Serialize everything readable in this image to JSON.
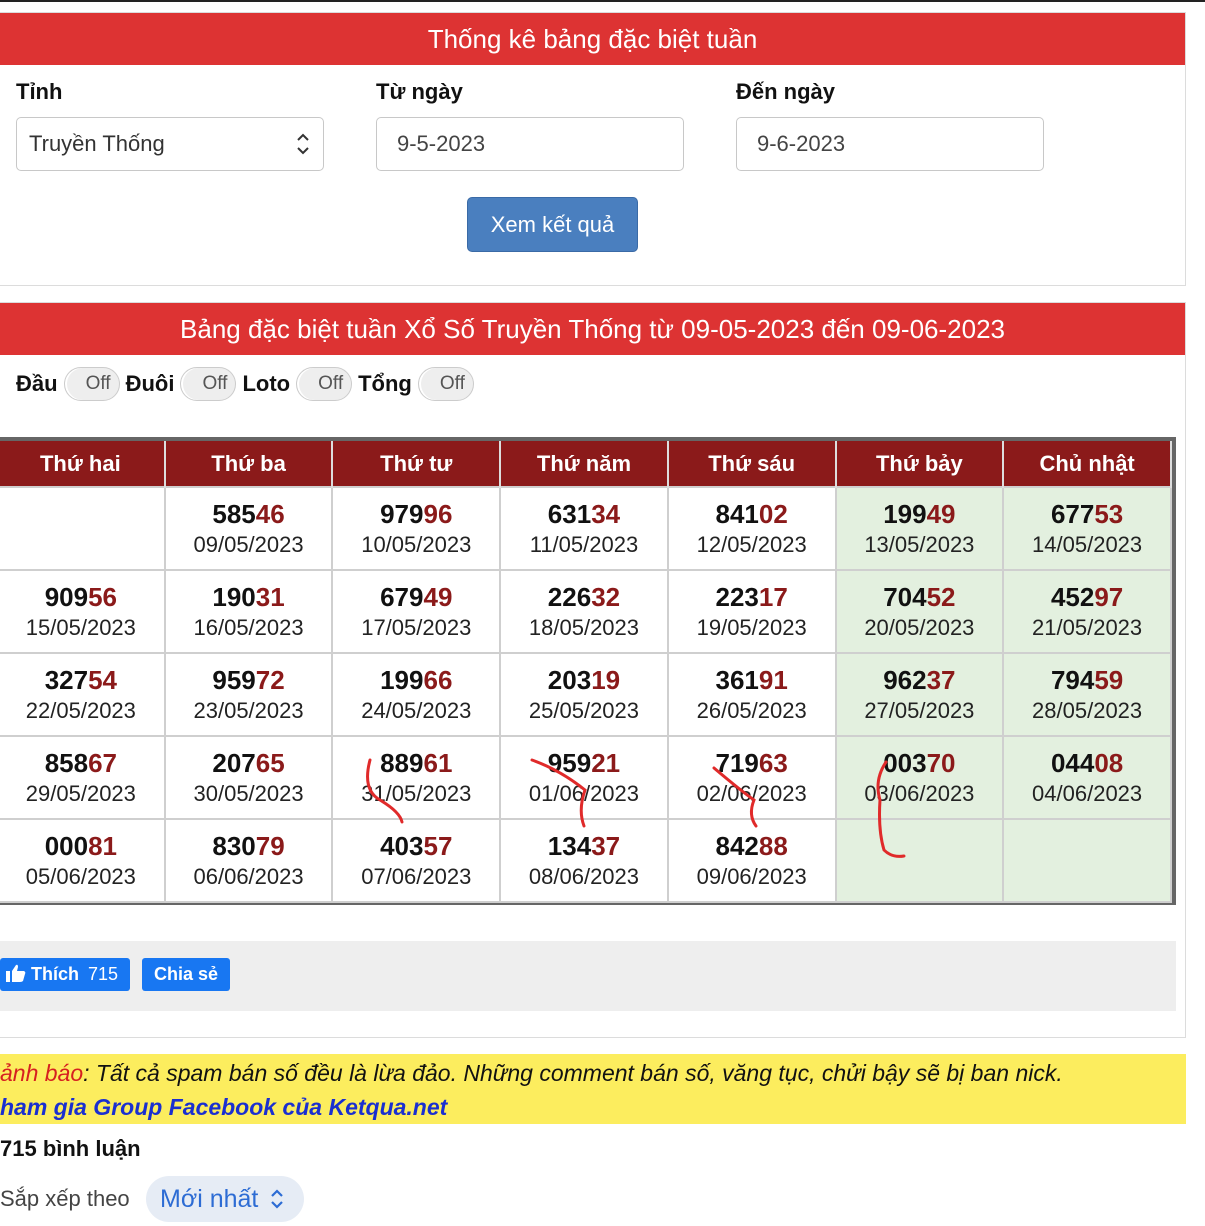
{
  "form": {
    "title": "Thống kê bảng đặc biệt tuần",
    "province_label": "Tỉnh",
    "province_value": "Truyền Thống",
    "from_label": "Từ ngày",
    "from_value": "9-5-2023",
    "to_label": "Đến ngày",
    "to_value": "9-6-2023",
    "submit_label": "Xem kết quả"
  },
  "table_panel": {
    "title": "Bảng đặc biệt tuần Xổ Số Truyền Thống từ 09-05-2023 đến 09-06-2023",
    "toggles": [
      {
        "label": "Đầu",
        "state": "Off"
      },
      {
        "label": "Đuôi",
        "state": "Off"
      },
      {
        "label": "Loto",
        "state": "Off"
      },
      {
        "label": "Tổng",
        "state": "Off"
      }
    ],
    "days": [
      "Thứ hai",
      "Thứ ba",
      "Thứ tư",
      "Thứ năm",
      "Thứ sáu",
      "Thứ bảy",
      "Chủ nhật"
    ],
    "rows": [
      [
        null,
        {
          "head": "585",
          "tail": "46",
          "date": "09/05/2023"
        },
        {
          "head": "979",
          "tail": "96",
          "date": "10/05/2023"
        },
        {
          "head": "631",
          "tail": "34",
          "date": "11/05/2023"
        },
        {
          "head": "841",
          "tail": "02",
          "date": "12/05/2023"
        },
        {
          "head": "199",
          "tail": "49",
          "date": "13/05/2023"
        },
        {
          "head": "677",
          "tail": "53",
          "date": "14/05/2023"
        }
      ],
      [
        {
          "head": "909",
          "tail": "56",
          "date": "15/05/2023"
        },
        {
          "head": "190",
          "tail": "31",
          "date": "16/05/2023"
        },
        {
          "head": "679",
          "tail": "49",
          "date": "17/05/2023"
        },
        {
          "head": "226",
          "tail": "32",
          "date": "18/05/2023"
        },
        {
          "head": "223",
          "tail": "17",
          "date": "19/05/2023"
        },
        {
          "head": "704",
          "tail": "52",
          "date": "20/05/2023"
        },
        {
          "head": "452",
          "tail": "97",
          "date": "21/05/2023"
        }
      ],
      [
        {
          "head": "327",
          "tail": "54",
          "date": "22/05/2023"
        },
        {
          "head": "959",
          "tail": "72",
          "date": "23/05/2023"
        },
        {
          "head": "199",
          "tail": "66",
          "date": "24/05/2023"
        },
        {
          "head": "203",
          "tail": "19",
          "date": "25/05/2023"
        },
        {
          "head": "361",
          "tail": "91",
          "date": "26/05/2023"
        },
        {
          "head": "962",
          "tail": "37",
          "date": "27/05/2023"
        },
        {
          "head": "794",
          "tail": "59",
          "date": "28/05/2023"
        }
      ],
      [
        {
          "head": "858",
          "tail": "67",
          "date": "29/05/2023"
        },
        {
          "head": "207",
          "tail": "65",
          "date": "30/05/2023"
        },
        {
          "head": "889",
          "tail": "61",
          "date": "31/05/2023"
        },
        {
          "head": "959",
          "tail": "21",
          "date": "01/06/2023"
        },
        {
          "head": "719",
          "tail": "63",
          "date": "02/06/2023"
        },
        {
          "head": "003",
          "tail": "70",
          "date": "03/06/2023"
        },
        {
          "head": "044",
          "tail": "08",
          "date": "04/06/2023"
        }
      ],
      [
        {
          "head": "000",
          "tail": "81",
          "date": "05/06/2023"
        },
        {
          "head": "830",
          "tail": "79",
          "date": "06/06/2023"
        },
        {
          "head": "403",
          "tail": "57",
          "date": "07/06/2023"
        },
        {
          "head": "134",
          "tail": "37",
          "date": "08/06/2023"
        },
        {
          "head": "842",
          "tail": "88",
          "date": "09/06/2023"
        },
        null,
        null
      ]
    ]
  },
  "share": {
    "like_label": "Thích",
    "like_count": "715",
    "share_label": "Chia sẻ"
  },
  "warning": {
    "prefix": "ảnh báo",
    "text": ": Tất cả spam bán số đều là lừa đảo. Những comment bán số, văng tục, chửi bậy sẽ bị ban nick.",
    "group_link": "ham gia Group Facebook của Ketqua.net"
  },
  "comments": {
    "count_label": "715 bình luận",
    "sort_label": "Sắp xếp theo",
    "sort_value": "Mới nhất"
  },
  "colors": {
    "header_red": "#dd3333",
    "table_header": "#8b1a1a",
    "weekend_bg": "#e3f0df",
    "button_blue": "#4a7fbf",
    "fb_blue": "#1877f2",
    "annotation_red": "#e02a2a"
  }
}
